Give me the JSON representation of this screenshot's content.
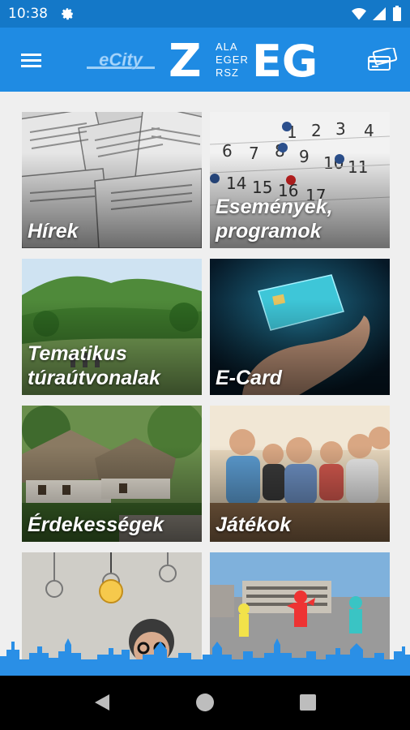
{
  "status_bar": {
    "time": "10:38",
    "icons": [
      "gear-icon",
      "wifi-icon",
      "signal-icon",
      "battery-icon"
    ]
  },
  "app_bar": {
    "menu_icon": "hamburger-menu-icon",
    "ecity_logo_text": "eCity",
    "zeg_logo": {
      "big_z": "Z",
      "small_lines": [
        "ALA",
        "EGER",
        "RSZ"
      ],
      "big_eg": "EG"
    },
    "right_icon": "credit-cards-icon"
  },
  "tiles": [
    {
      "label": "Hírek"
    },
    {
      "label": "Események,\nprogramok"
    },
    {
      "label": "Tematikus\ntúraútvonalak"
    },
    {
      "label": "E-Card"
    },
    {
      "label": "Érdekességek"
    },
    {
      "label": "Játékok"
    },
    {
      "label": ""
    },
    {
      "label": ""
    }
  ],
  "calendar_numbers": [
    "1",
    "2",
    "3",
    "4",
    "6",
    "7",
    "8",
    "9",
    "10",
    "11",
    "14",
    "15",
    "16",
    "17"
  ],
  "nav_bar": {
    "icons": [
      "back-icon",
      "home-icon",
      "recents-icon"
    ]
  },
  "colors": {
    "status_bar": "#1478c8",
    "app_bar": "#1f8be3",
    "skyline": "#2a8fe6",
    "background": "#efefef"
  }
}
